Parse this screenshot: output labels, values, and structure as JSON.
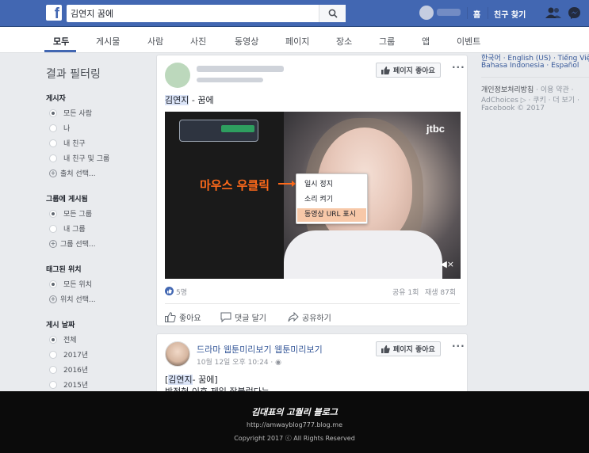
{
  "topbar": {
    "logo": "f",
    "search_value": "김연지 꿈에",
    "nav_home": "홈",
    "nav_find_friends": "친구 찾기"
  },
  "tabs": [
    "모두",
    "게시물",
    "사람",
    "사진",
    "동영상",
    "페이지",
    "장소",
    "그룹",
    "앱",
    "이벤트"
  ],
  "filters": {
    "title": "결과 필터링",
    "sections": [
      {
        "label": "게시자",
        "options": [
          "모든 사람",
          "나",
          "내 친구",
          "내 친구 및 그룹"
        ],
        "selected": 0,
        "more": "출처 선택..."
      },
      {
        "label": "그룹에 게시됨",
        "options": [
          "모든 그룹",
          "내 그룹"
        ],
        "selected": 0,
        "more": "그룹 선택..."
      },
      {
        "label": "태그된 위치",
        "options": [
          "모든 위치"
        ],
        "selected": 0,
        "more": "위치 선택..."
      },
      {
        "label": "게시 날짜",
        "options": [
          "전체",
          "2017년",
          "2016년",
          "2015년"
        ],
        "selected": 0
      }
    ]
  },
  "post1": {
    "like_page": "페이지 좋아요",
    "title_name": "김연지",
    "title_rest": " - 꿈에",
    "video": {
      "channel": "jtbc",
      "overlay_label": "마우스 우클릭",
      "context_menu": [
        "일시 정지",
        "소리 켜기",
        "동영상 URL 표시"
      ],
      "selected_item": 2
    },
    "likes": "5명",
    "shares": "공유 1회",
    "views": "재생 87회",
    "actions": {
      "like": "좋아요",
      "comment": "댓글 달기",
      "share": "공유하기"
    }
  },
  "post2": {
    "page_name": "드라마 웹툰미리보기 웹툰미리보기",
    "time": "10월 12일 오후 10:24 · ",
    "like_page": "페이지 좋아요",
    "text_open": "[",
    "text_name": "김연지",
    "text_rest": "- 꿈에]",
    "text_line2": "박정현 이후 제일 잘불렀다는..."
  },
  "right": {
    "lang_line1": "한국어 · English (US) · Tiếng Việt",
    "lang_line2": "Bahasa Indonesia · Español",
    "links_line1_a": "개인정보처리방침",
    "links_line1_b": " · 이용 약관 ·",
    "links_line2": "AdChoices ▷ · 쿠키 · 더 보기 ·",
    "copyright": "Facebook © 2017"
  },
  "footer": {
    "blog_title": "김대표의 고퀄리 블로그",
    "url": "http://amwayblog777.blog.me",
    "copyright": "Copyright 2017 ⓒ All Rights Reserved"
  }
}
